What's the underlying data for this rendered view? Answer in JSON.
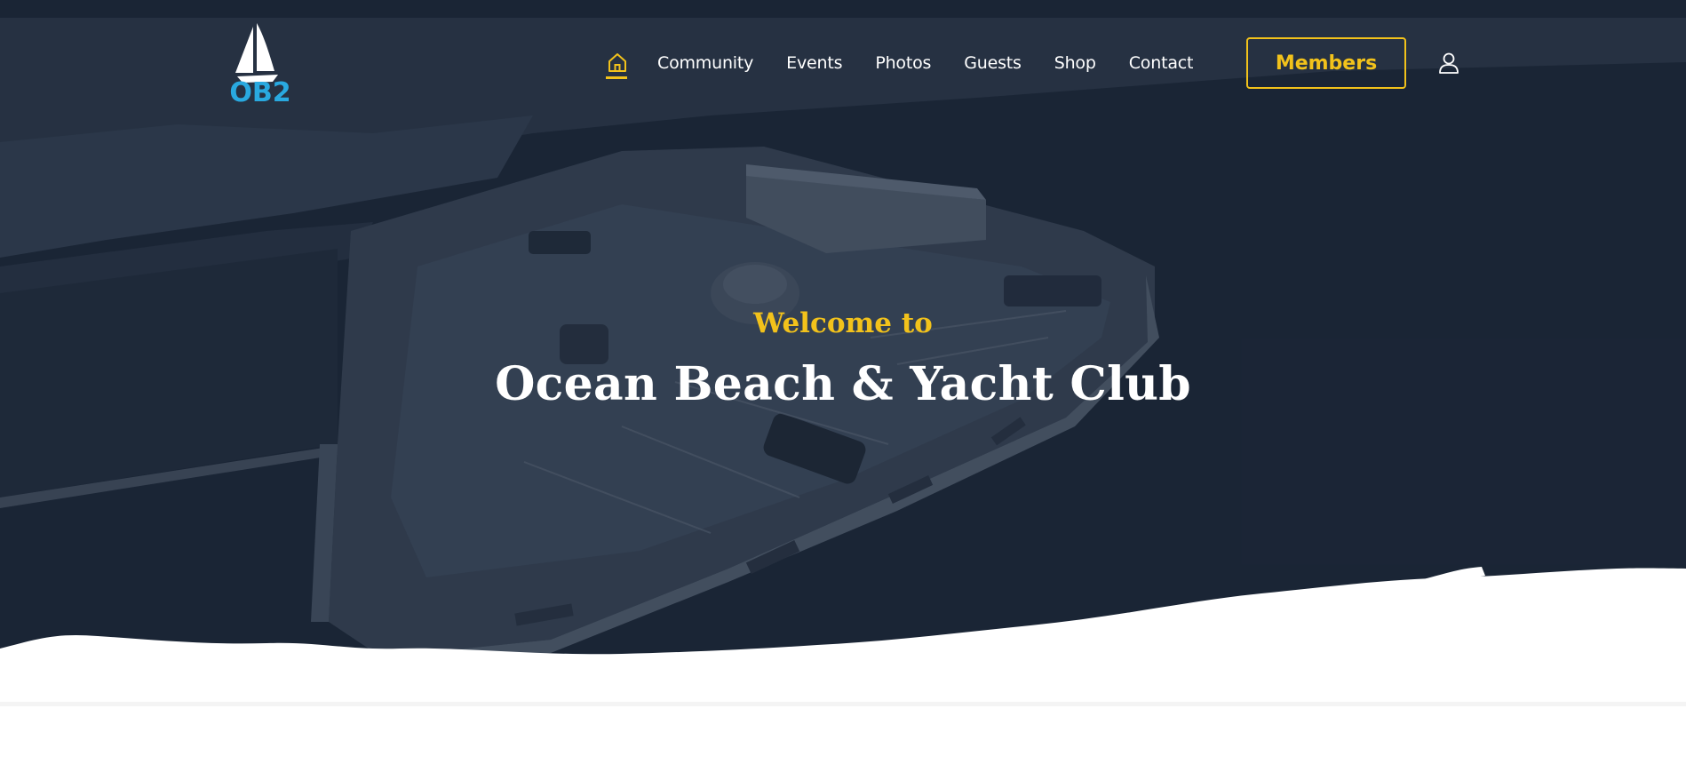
{
  "site": {
    "logo_text": "OB2",
    "brand_color": "#29a9e0",
    "accent_color": "#f2c21b"
  },
  "nav": {
    "home_icon": "home-icon",
    "items": [
      {
        "label": "Community"
      },
      {
        "label": "Events"
      },
      {
        "label": "Photos"
      },
      {
        "label": "Guests"
      },
      {
        "label": "Shop"
      },
      {
        "label": "Contact"
      }
    ],
    "members_label": "Members",
    "account_icon": "user-icon"
  },
  "hero": {
    "welcome": "Welcome to",
    "title": "Ocean Beach & Yacht Club"
  }
}
